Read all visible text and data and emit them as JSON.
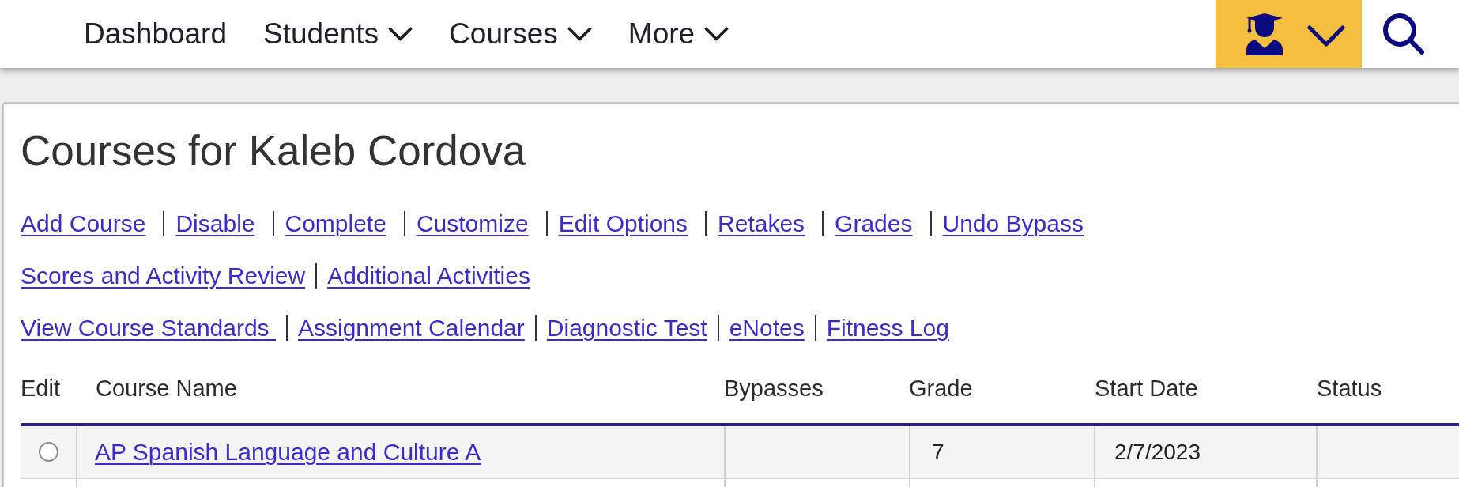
{
  "nav": {
    "items": [
      {
        "label": "Dashboard",
        "has_menu": false
      },
      {
        "label": "Students",
        "has_menu": true
      },
      {
        "label": "Courses",
        "has_menu": true
      },
      {
        "label": "More",
        "has_menu": true
      }
    ]
  },
  "page": {
    "title": "Courses for Kaleb Cordova",
    "link_rows": [
      [
        "Add Course",
        "Disable",
        "Complete",
        "Customize",
        "Edit Options",
        "Retakes",
        "Grades",
        "Undo Bypass"
      ],
      [
        "Scores and Activity Review",
        "Additional Activities"
      ],
      [
        "View Course Standards ",
        "Assignment Calendar",
        "Diagnostic Test",
        "eNotes",
        "Fitness Log"
      ]
    ]
  },
  "table": {
    "columns": [
      "Edit",
      "Course Name",
      "Bypasses",
      "Grade",
      "Start Date",
      "Status"
    ],
    "rows": [
      {
        "selected": false,
        "course_name": "AP Spanish Language and Culture A",
        "grade": "7",
        "start_date": "2/7/2023"
      }
    ]
  }
}
